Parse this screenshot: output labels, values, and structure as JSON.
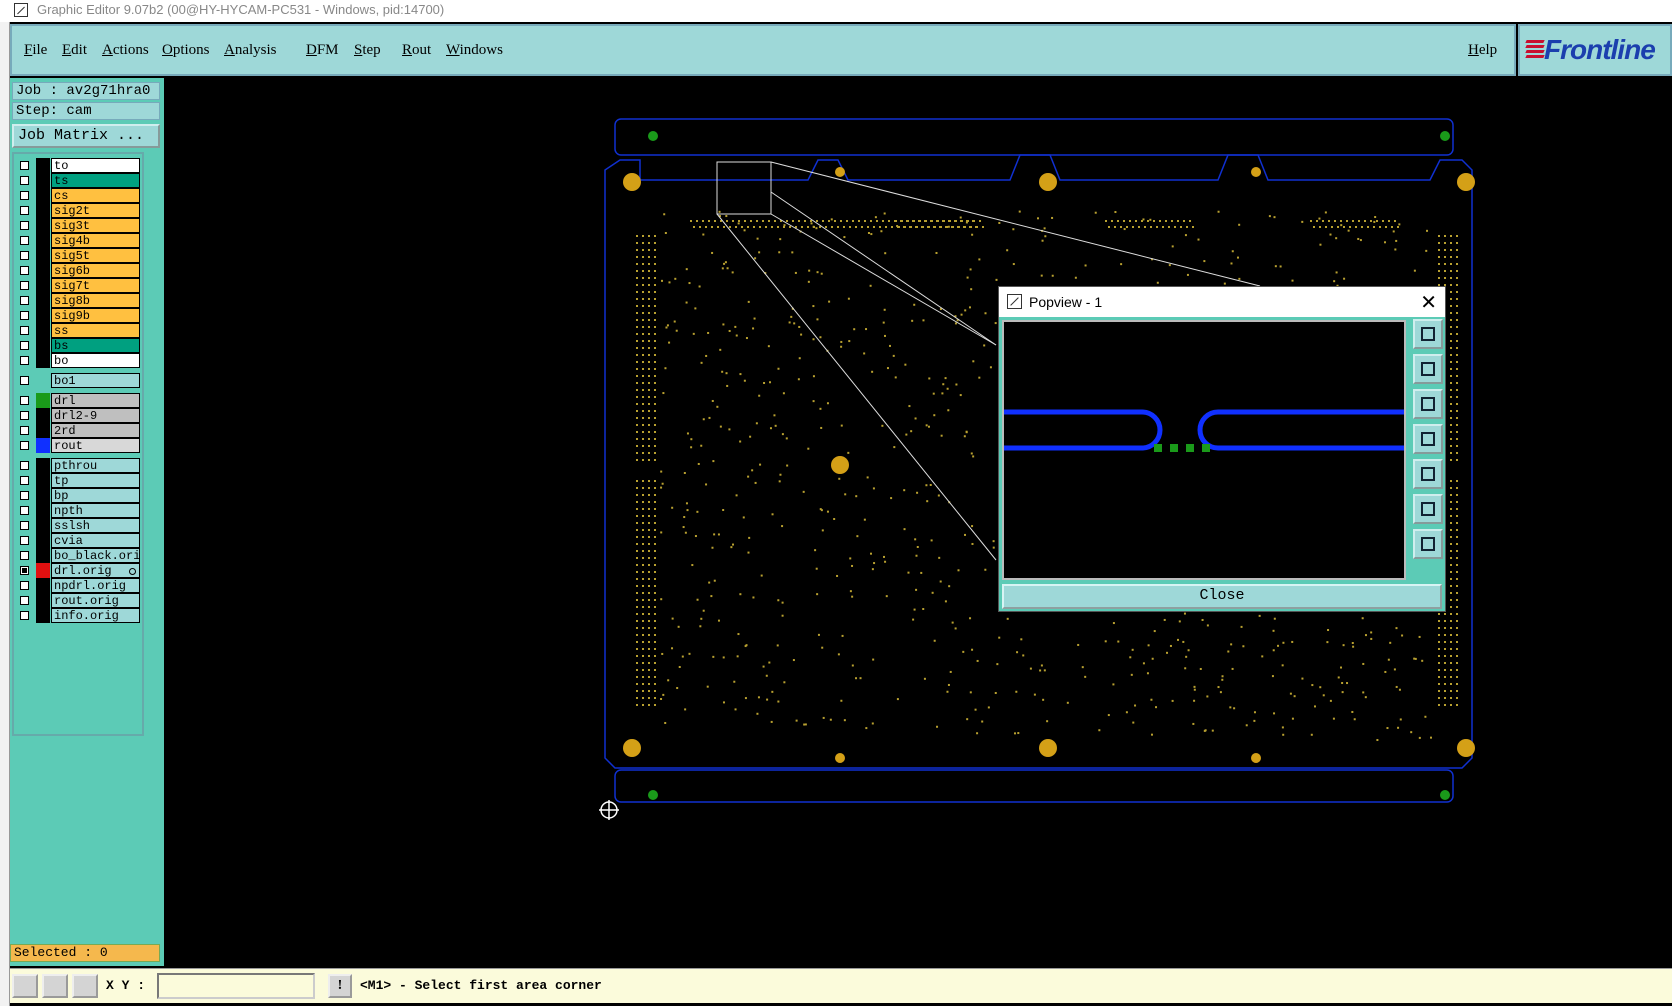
{
  "window": {
    "title": "Graphic Editor 9.07b2 (00@HY-HYCAM-PC531 - Windows, pid:14700)"
  },
  "menu": {
    "items": [
      "File",
      "Edit",
      "Actions",
      "Options",
      "Analysis",
      "DFM",
      "Step",
      "Rout",
      "Windows"
    ],
    "help": "Help"
  },
  "brand": {
    "name": "Frontline",
    "color": "#1b3fae",
    "accent": "#c8102e"
  },
  "job": {
    "label": "Job : av2g71hra0",
    "step": "Step: cam",
    "matrix_button": "Job Matrix ..."
  },
  "layers": [
    {
      "name": "to",
      "color": "#ffffff"
    },
    {
      "name": "ts",
      "color": "#00a080"
    },
    {
      "name": "cs",
      "color": "#ffc040"
    },
    {
      "name": "sig2t",
      "color": "#ffc040"
    },
    {
      "name": "sig3t",
      "color": "#ffc040"
    },
    {
      "name": "sig4b",
      "color": "#ffc040"
    },
    {
      "name": "sig5t",
      "color": "#ffc040"
    },
    {
      "name": "sig6b",
      "color": "#ffc040"
    },
    {
      "name": "sig7t",
      "color": "#ffc040"
    },
    {
      "name": "sig8b",
      "color": "#ffc040"
    },
    {
      "name": "sig9b",
      "color": "#ffc040"
    },
    {
      "name": "ss",
      "color": "#ffc040"
    },
    {
      "name": "bs",
      "color": "#00a080"
    },
    {
      "name": "bo",
      "color": "#ffffff"
    },
    {
      "name": "bo1",
      "color": "#9ed8d8",
      "noswatch": true
    },
    {
      "name": "drl",
      "color": "#bfbfbf",
      "swatch": "#1a9a1a"
    },
    {
      "name": "drl2-9",
      "color": "#bfbfbf"
    },
    {
      "name": "2rd",
      "color": "#bfbfbf"
    },
    {
      "name": "rout",
      "color": "#d8d8d8",
      "swatch": "#1030ff"
    },
    {
      "name": "pthrou",
      "color": "#9ed8d8"
    },
    {
      "name": "tp",
      "color": "#9ed8d8"
    },
    {
      "name": "bp",
      "color": "#9ed8d8"
    },
    {
      "name": "npth",
      "color": "#9ed8d8"
    },
    {
      "name": "sslsh",
      "color": "#9ed8d8"
    },
    {
      "name": "cvia",
      "color": "#9ed8d8"
    },
    {
      "name": "bo_black.ori",
      "color": "#9ed8d8"
    },
    {
      "name": "drl.orig",
      "color": "#9ed8d8",
      "swatch": "#e01010",
      "checked": true,
      "marker": true
    },
    {
      "name": "npdrl.orig",
      "color": "#9ed8d8"
    },
    {
      "name": "rout.orig",
      "color": "#9ed8d8"
    },
    {
      "name": "info.orig",
      "color": "#9ed8d8"
    }
  ],
  "status": {
    "selected": "Selected : 0",
    "xy_label": "X Y :",
    "xy_value": "",
    "warn": "!",
    "message": "<M1> - Select first area corner"
  },
  "popview": {
    "title": "Popview - 1",
    "close_label": "Close"
  },
  "colors": {
    "board_outline": "#1030d0",
    "pad_gold": "#d4a017",
    "drill_green": "#1a9a1a",
    "dots": "#b8a030",
    "panel_bg": "#5ccbb6",
    "menu_bg": "#9ed8d8",
    "status_bg": "#fbfbdb"
  }
}
